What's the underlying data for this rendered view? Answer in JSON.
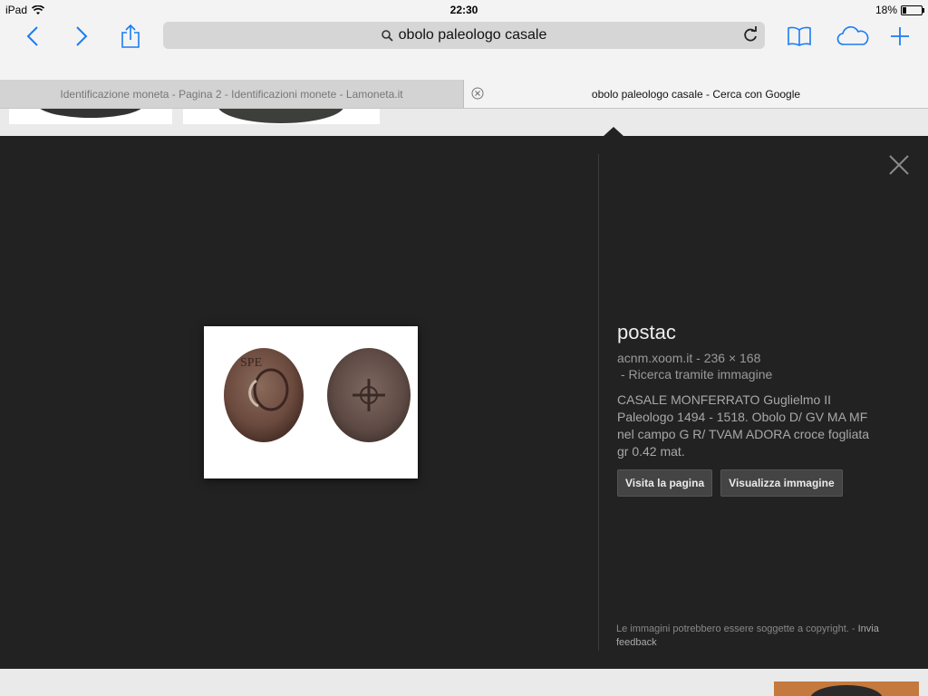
{
  "status": {
    "device": "iPad",
    "time": "22:30",
    "battery": "18%",
    "battery_fraction": 0.18
  },
  "toolbar": {
    "address": "obolo paleologo casale",
    "icons": [
      "chevron-left-icon",
      "chevron-right-icon",
      "share-icon",
      "search-icon",
      "reload-icon",
      "bookmarks-icon",
      "icloud-tabs-icon",
      "plus-icon"
    ],
    "accent": "#1a7cf5"
  },
  "tabs": [
    {
      "label": "Identificazione moneta - Pagina 2 - Identificazioni monete - Lamoneta.it",
      "active": false
    },
    {
      "label": "obolo paleologo casale - Cerca con Google",
      "active": true
    }
  ],
  "detail": {
    "title": "postac",
    "source": "acnm.xoom.it",
    "separator": "-",
    "dimensions": "236 × 168",
    "search_by_image": "- Ricerca tramite immagine",
    "description": "CASALE MONFERRATO Guglielmo II Paleologo 1494 - 1518. Obolo D/ GV MA MF nel campo G R/ TVAM ADORA croce fogliata gr 0.42 mat.",
    "visit_button": "Visita la pagina",
    "view_button": "Visualizza immagine",
    "copyright": "Le immagini potrebbero essere soggette a copyright. -",
    "feedback": "Invia feedback"
  },
  "colors": {
    "panel_bg": "#222222",
    "chrome_bg": "#f3f3f3"
  }
}
